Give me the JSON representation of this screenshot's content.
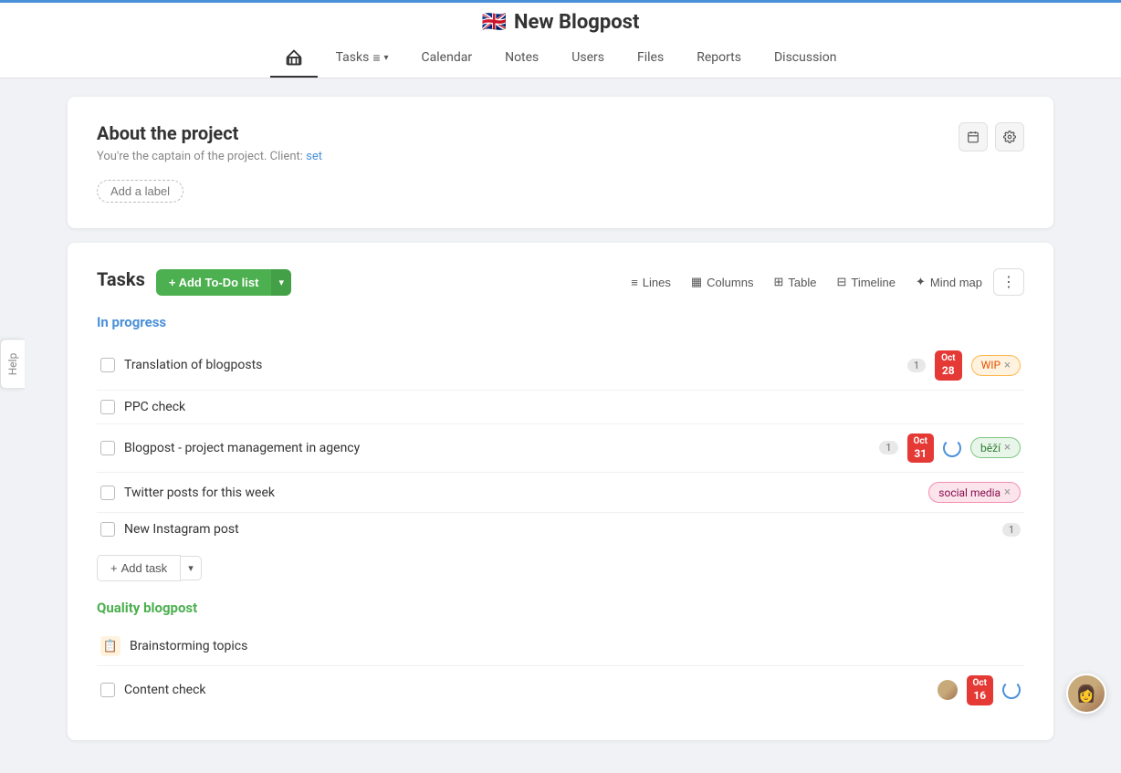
{
  "header": {
    "accent_color": "#4a90d9",
    "flag_emoji": "🇬🇧",
    "title": "New Blogpost",
    "nav": [
      {
        "id": "home",
        "label": "",
        "icon": "home",
        "active": true
      },
      {
        "id": "tasks",
        "label": "Tasks",
        "icon": "list",
        "active": false,
        "has_dropdown": true
      },
      {
        "id": "calendar",
        "label": "Calendar",
        "active": false
      },
      {
        "id": "notes",
        "label": "Notes",
        "active": false
      },
      {
        "id": "users",
        "label": "Users",
        "active": false
      },
      {
        "id": "files",
        "label": "Files",
        "active": false
      },
      {
        "id": "reports",
        "label": "Reports",
        "active": false
      },
      {
        "id": "discussion",
        "label": "Discussion",
        "active": false
      }
    ]
  },
  "about_card": {
    "title": "About the project",
    "subtitle": "You're the captain of the project. Client:",
    "client_link": "set",
    "add_label": "Add a label"
  },
  "tasks_card": {
    "title": "Tasks",
    "add_todo_label": "+ Add To-Do list",
    "view_buttons": [
      {
        "id": "lines",
        "label": "Lines",
        "icon": "≡"
      },
      {
        "id": "columns",
        "label": "Columns",
        "icon": "▦"
      },
      {
        "id": "table",
        "label": "Table",
        "icon": "⊞"
      },
      {
        "id": "timeline",
        "label": "Timeline",
        "icon": "⊟"
      },
      {
        "id": "mindmap",
        "label": "Mind map",
        "icon": "✦"
      }
    ],
    "sections": [
      {
        "id": "in-progress",
        "title": "In progress",
        "color": "blue",
        "tasks": [
          {
            "id": 1,
            "name": "Translation of blogposts",
            "count": 1,
            "date_month": "Oct",
            "date_day": "28",
            "has_date": true,
            "tag": "WIP",
            "tag_style": "wip"
          },
          {
            "id": 2,
            "name": "PPC check",
            "has_date": false,
            "tag": null
          },
          {
            "id": 3,
            "name": "Blogpost - project management in agency",
            "count": 1,
            "date_month": "Oct",
            "date_day": "31",
            "has_date": true,
            "has_progress": true,
            "tag": "běží",
            "tag_style": "bezi"
          },
          {
            "id": 4,
            "name": "Twitter posts for this week",
            "has_date": false,
            "tag": "social media",
            "tag_style": "social"
          },
          {
            "id": 5,
            "name": "New Instagram post",
            "count": 1,
            "has_date": false,
            "tag": null
          }
        ],
        "add_task_label": "Add task"
      },
      {
        "id": "quality-blogpost",
        "title": "Quality blogpost",
        "color": "green",
        "tasks": [
          {
            "id": 6,
            "name": "Brainstorming topics",
            "icon": "brainstorm",
            "has_date": false,
            "tag": null
          },
          {
            "id": 7,
            "name": "Content check",
            "has_date": true,
            "date_month": "Oct",
            "date_day": "16",
            "has_avatar": true,
            "has_progress": true,
            "tag": null
          }
        ]
      }
    ]
  },
  "help_label": "Help"
}
